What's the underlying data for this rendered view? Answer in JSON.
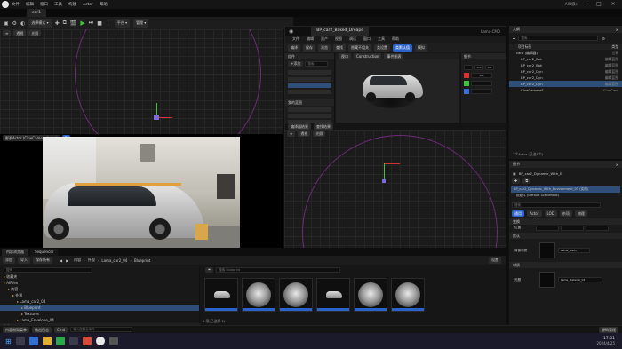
{
  "menubar": {
    "items": [
      "文件",
      "编辑",
      "窗口",
      "工具",
      "构建",
      "Actor",
      "帮助"
    ],
    "title": "AIR级s"
  },
  "tabs": {
    "level_tab": "car1"
  },
  "toolbar": {
    "mode_label": "选择模式",
    "platform_label": "平台",
    "more_label": "管理"
  },
  "viewport_top": {
    "perspective": "透视",
    "lit": "光照"
  },
  "cine_viewport": {
    "label": "影视Actor (CineCameraActor)",
    "blend_label": "B"
  },
  "blueprint": {
    "tab_label": "BP_car2_Baked_Dreape",
    "tab2_label": "Lama-CMO",
    "menu": [
      "文件",
      "编辑",
      "资产",
      "视图",
      "调试",
      "窗口",
      "工具",
      "帮助"
    ],
    "toolbar": [
      "编译",
      "保存",
      "浏览",
      "查找",
      "隐藏不相关",
      "类设置",
      "类默认值",
      "模拟",
      "播放"
    ],
    "components_title": "组件",
    "add_label": "+添加",
    "search_placeholder": "搜索",
    "viewport_tab": "视口",
    "construction_tab": "Construction",
    "event_tab": "事件图表",
    "details_title": "细节",
    "my_blueprint": "我的蓝图",
    "bottom_tabs": [
      "编译器结果",
      "查找结果"
    ],
    "color_values": [
      "0.0",
      "0.0",
      "0.0"
    ]
  },
  "viewport_bottom": {
    "perspective": "透视",
    "lit": "光照"
  },
  "outliner": {
    "title": "大纲",
    "search_placeholder": "搜索...",
    "col_label": "项目标签",
    "col_type": "类型",
    "items": [
      {
        "label": "car1 (编辑器)",
        "type": "世界",
        "indent": 0,
        "selected": false
      },
      {
        "label": "BP_car2_Bak",
        "type": "编辑蓝图",
        "indent": 1,
        "selected": false
      },
      {
        "label": "BP_car2_Bak",
        "type": "编辑蓝图",
        "indent": 1,
        "selected": false
      },
      {
        "label": "BP_car2_Dyn",
        "type": "编辑蓝图",
        "indent": 1,
        "selected": false
      },
      {
        "label": "BP_car2_Dyn",
        "type": "编辑蓝图",
        "indent": 1,
        "selected": false
      },
      {
        "label": "BP_car2_Dyn",
        "type": "编辑蓝图",
        "indent": 1,
        "selected": true
      },
      {
        "label": "CineCameraF",
        "type": "CineCam",
        "indent": 1,
        "selected": false
      }
    ],
    "footer": "7个Actor (已选1个)"
  },
  "details": {
    "title": "细节",
    "actor_label": "BP_car2_Dynamic_With_E",
    "instance_label": "BP_car2_Dynamic_With_Environment_03 (实例)",
    "sub_label": "根组件 (Default SceneRoot)",
    "search_placeholder": "搜索",
    "tabs": [
      "通用",
      "Actor",
      "LOD",
      "杂项",
      "物理",
      "渲染",
      "流送",
      "全部"
    ],
    "sections": [
      "变换",
      "默认",
      "材质"
    ],
    "field_labels": [
      "位置",
      "背景材质",
      "光照"
    ],
    "asset_label": "Lama_Manu",
    "asset2_label": "Lama_Material_04"
  },
  "content_browser": {
    "tab1": "内容浏览器",
    "tab2": "Sequencer",
    "add_label": "添加",
    "import_label": "导入",
    "save_label": "保存所有",
    "path": [
      "内容",
      "外观",
      "Lama_car2_04",
      "Blueprint"
    ],
    "settings_label": "设置",
    "tree_search": "搜索",
    "filter_search": "搜索 Blueprint",
    "tree": [
      {
        "label": "收藏夹",
        "indent": 0,
        "selected": false
      },
      {
        "label": "AIRfex",
        "indent": 0,
        "selected": false
      },
      {
        "label": "内容",
        "indent": 1,
        "selected": false
      },
      {
        "label": "外观",
        "indent": 2,
        "selected": false
      },
      {
        "label": "Lama_car2_04",
        "indent": 3,
        "selected": false
      },
      {
        "label": "Blueprint",
        "indent": 4,
        "selected": true
      },
      {
        "label": "Textures",
        "indent": 4,
        "selected": false
      },
      {
        "label": "Lama_Envelope_04",
        "indent": 3,
        "selected": false
      },
      {
        "label": "Lama_Playfor_Marketing_04",
        "indent": 3,
        "selected": false
      }
    ],
    "footer": "6 项(已选择 1)",
    "collections": "集合"
  },
  "statusbar": {
    "drawer": "内容侧滑菜单",
    "log": "输出日志",
    "cmd": "Cmd",
    "cmd_placeholder": "输入控制台命令",
    "source": "源码管理"
  },
  "taskbar": {
    "time": "17:01",
    "date": "2024/4/25"
  },
  "colors": {
    "accent": "#2a63c9",
    "play": "#3dc43d",
    "x_axis": "#d93030",
    "y_axis": "#3dc43d",
    "arc": "#6d2a78"
  }
}
